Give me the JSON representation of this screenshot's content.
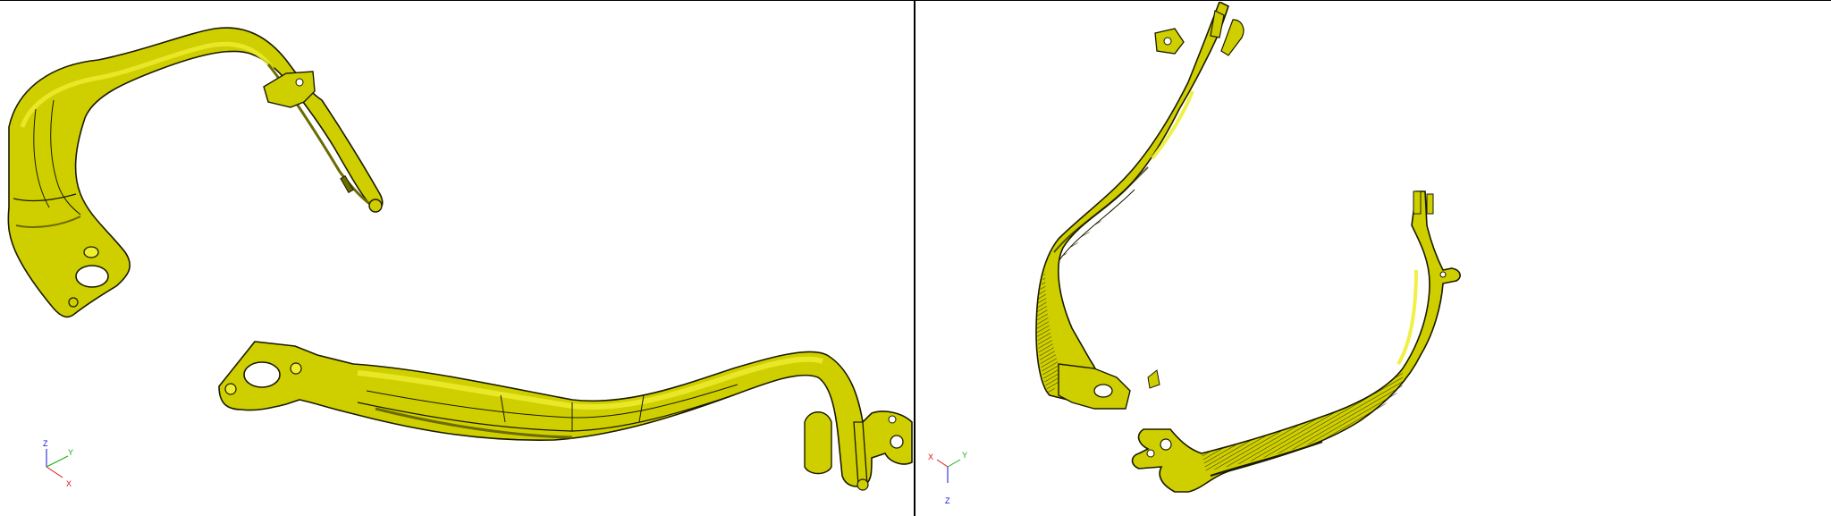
{
  "colors": {
    "part_fill": "#cfcf00",
    "part_highlight": "#eeee33",
    "part_shadow": "#6b6b00",
    "edge": "#1a1a00",
    "axis_x": "#e01010",
    "axis_y": "#10b010",
    "axis_z": "#1010e0",
    "background": "#ffffff"
  },
  "viewports": [
    {
      "id": "left",
      "triad": {
        "x": "X",
        "y": "Y",
        "z": "Z"
      }
    },
    {
      "id": "right",
      "triad": {
        "x": "X",
        "y": "Y",
        "z": "Z"
      }
    }
  ]
}
